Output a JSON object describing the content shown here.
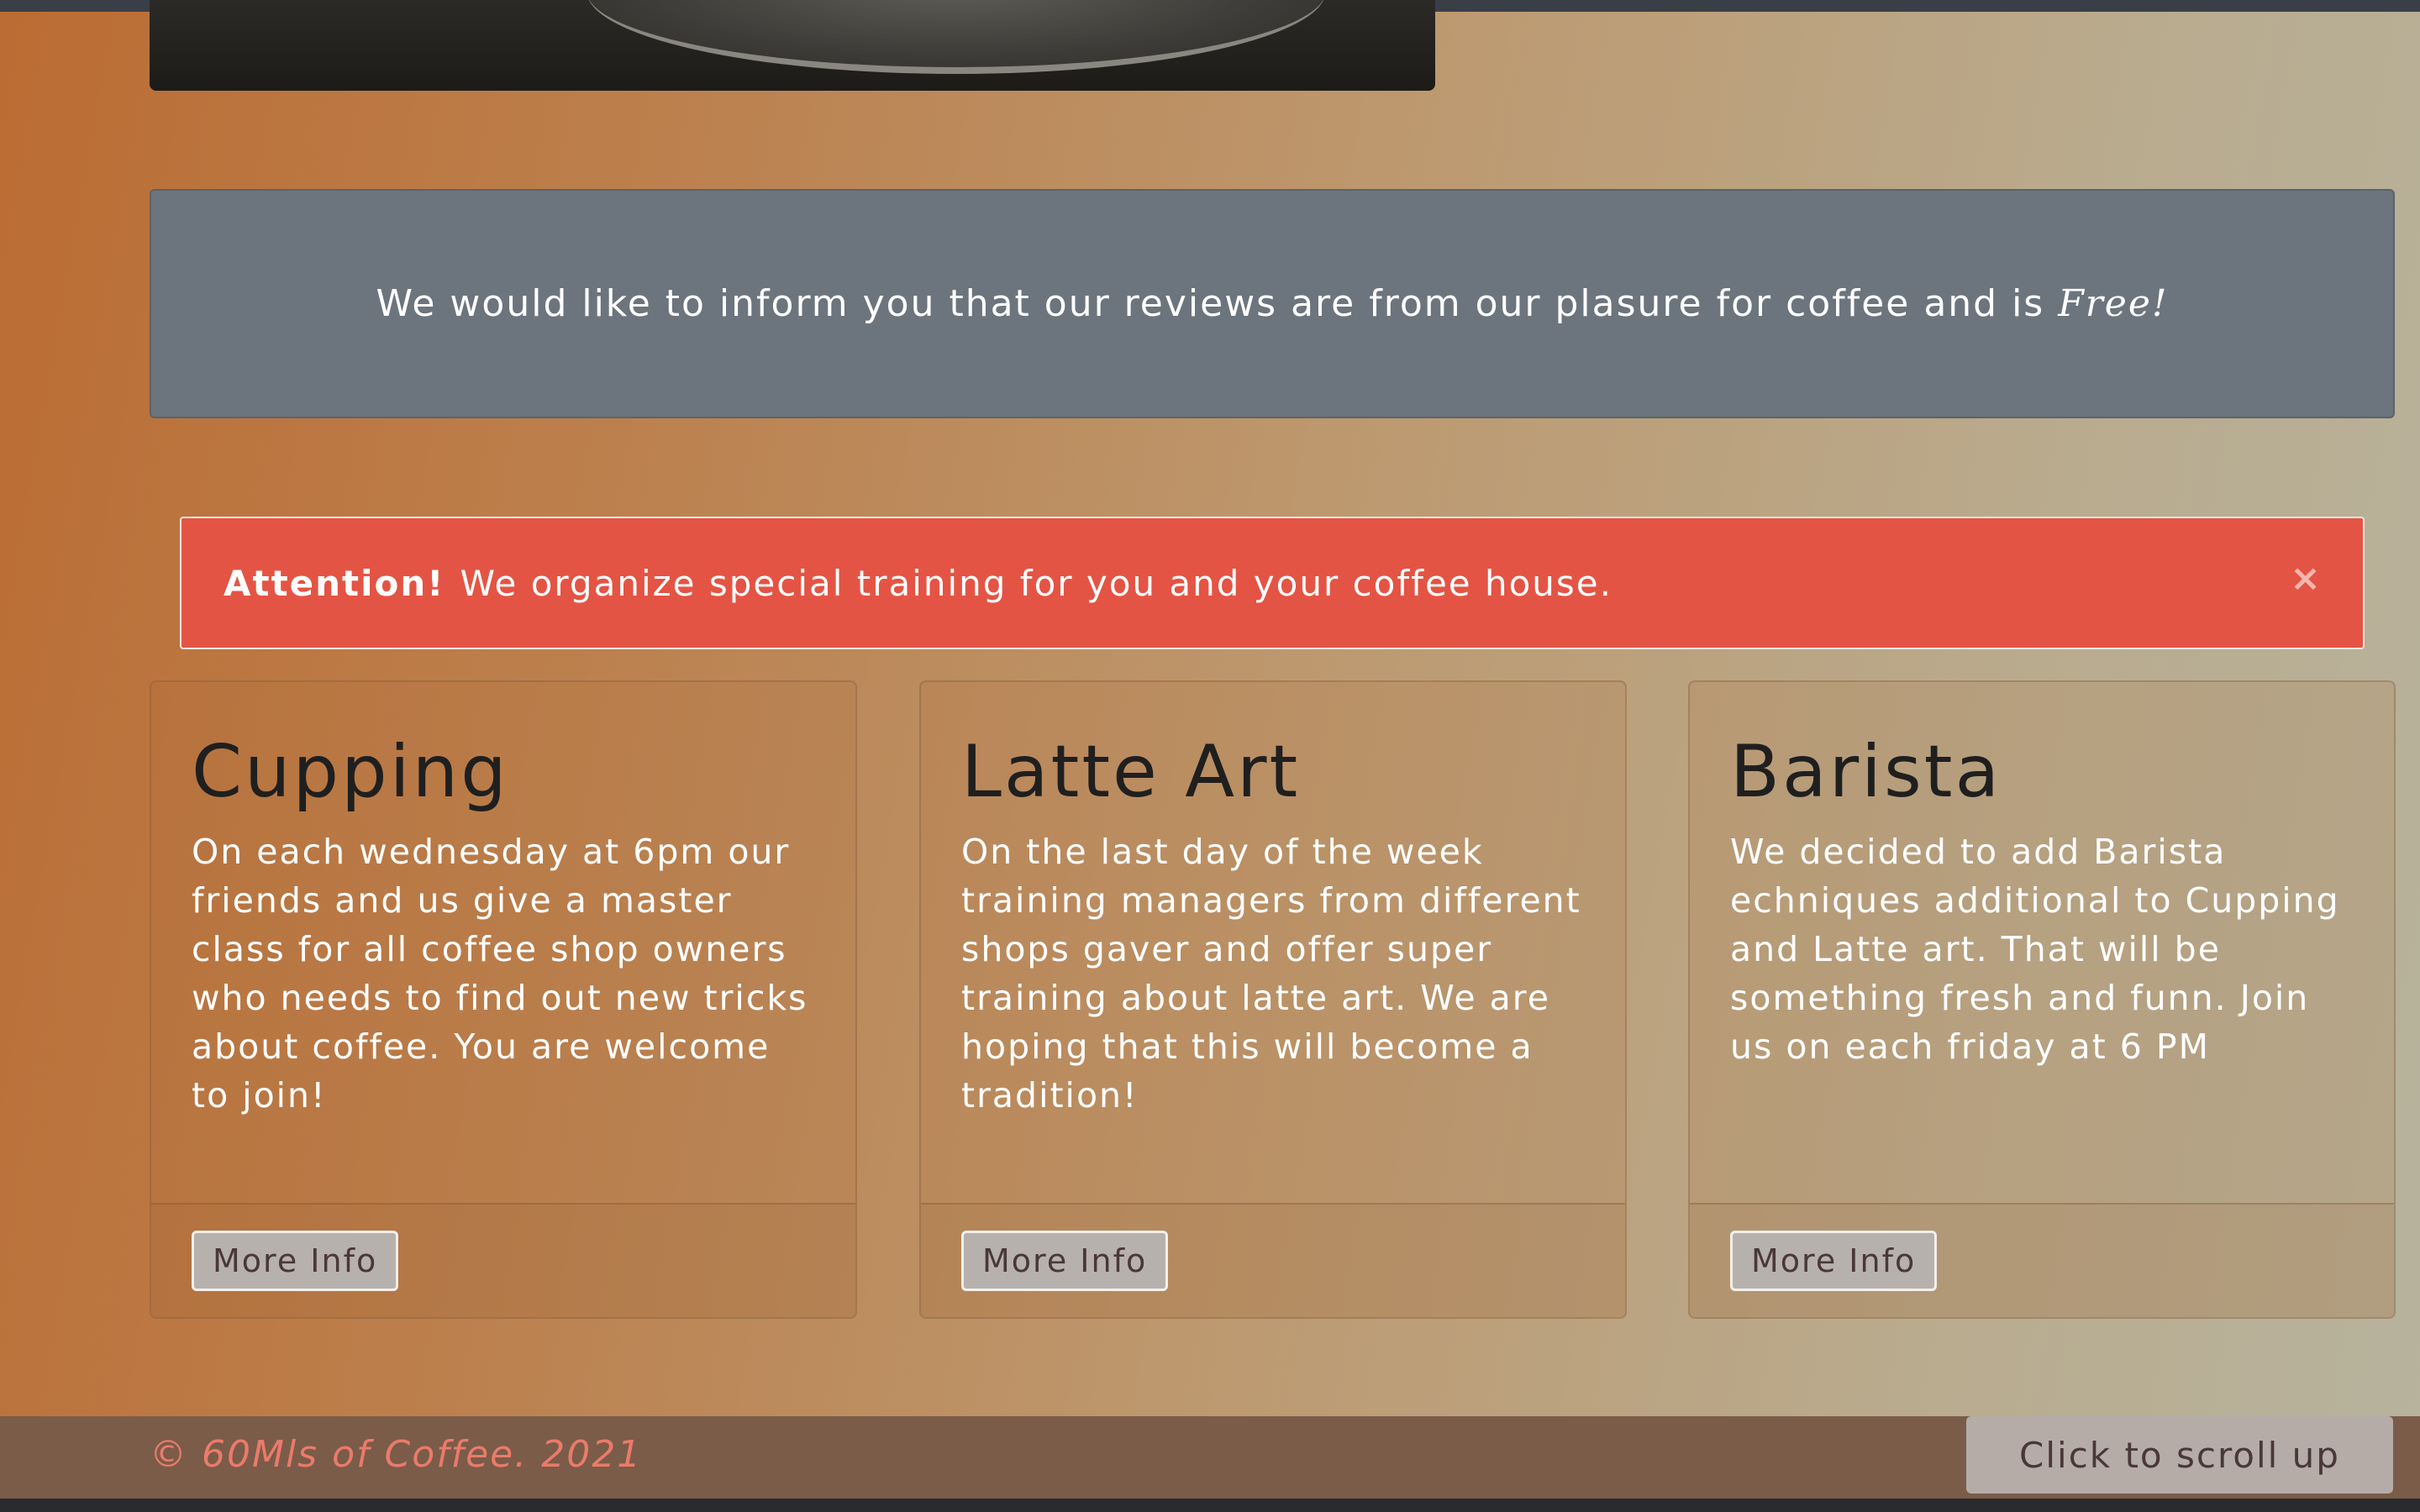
{
  "info_banner": {
    "text": "We would like to inform you that our reviews are from our plasure for coffee and is",
    "emphasis": "Free!"
  },
  "alert": {
    "strong": "Attention!",
    "text": "We organize special training for you and your coffee house.",
    "close_label": "×"
  },
  "cards": [
    {
      "title": "Cupping",
      "text": "On each wednesday at 6pm our friends and us give a master class for all coffee shop owners who needs to find out new tricks about coffee. You are welcome to join!",
      "button": "More Info"
    },
    {
      "title": "Latte Art",
      "text": "On the last day of the week training managers from different shops gaver and offer super training about latte art. We are hoping that this will become a tradition!",
      "button": "More Info"
    },
    {
      "title": "Barista",
      "text": "We decided to add Barista echniques additional to Cupping and Latte art. That will be something fresh and funn. Join us on each friday at 6 PM",
      "button": "More Info"
    }
  ],
  "footer": {
    "copyright": "© 60Mls of Coffee. 2021",
    "scroll_up": "Click to scroll up"
  },
  "colors": {
    "alert_bg": "#e45444",
    "info_bg": "#6c757d",
    "footer_bg": "#7a5c49",
    "footer_text": "#ec7a6a"
  }
}
